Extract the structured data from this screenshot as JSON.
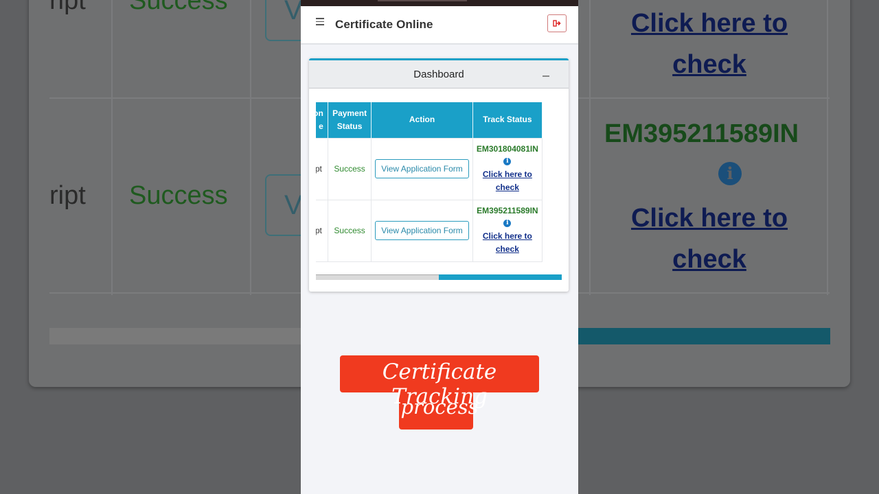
{
  "background": {
    "col_transcript_partial": "ript",
    "col_payment": "Success",
    "col_action_partial": "V",
    "em_code": "EM395211589IN",
    "link_line1": "Click here to",
    "link_line2": "check"
  },
  "app": {
    "title": "Certificate Online",
    "menu_icon": "hamburger-menu-icon",
    "logout_icon": "sign-out-icon"
  },
  "dashboard": {
    "title": "Dashboard",
    "collapse_icon": "minus-icon",
    "columns": [
      {
        "label_line1": "tion",
        "label_line2": "e"
      },
      {
        "label_line1": "Payment",
        "label_line2": "Status"
      },
      {
        "label_line1": "Action",
        "label_line2": ""
      },
      {
        "label_line1": "Track Status",
        "label_line2": ""
      }
    ],
    "rows": [
      {
        "prescript": "ript",
        "payment_status": "Success",
        "action_label": "View Application Form",
        "tracking_no": "EM301804081IN",
        "info_icon": "info-circle-icon",
        "link_line1": "Click here to",
        "link_line2": "check"
      },
      {
        "prescript": "ript",
        "payment_status": "Success",
        "action_label": "View Application Form",
        "tracking_no": "EM395211589IN",
        "info_icon": "info-circle-icon",
        "link_line1": "Click here to",
        "link_line2": "check"
      }
    ],
    "scroll_position": 0.5
  },
  "promo": {
    "line1": "Certificate Tracking",
    "line2": "process"
  },
  "colors": {
    "accent": "#1aa0c8",
    "success": "#2f8a2f",
    "link": "#112f8a",
    "promo_bg": "#f03a1f"
  }
}
